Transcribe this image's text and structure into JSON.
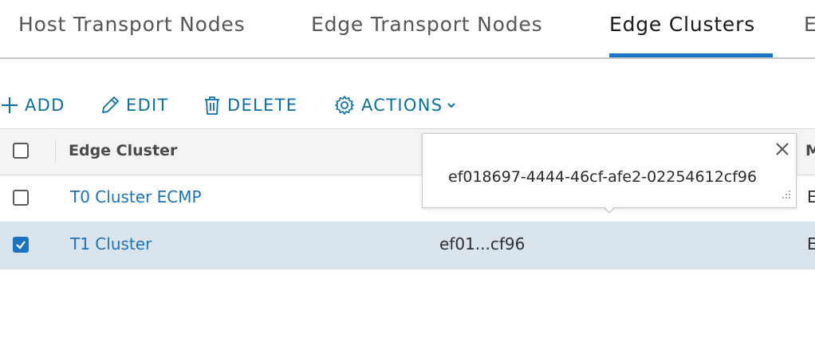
{
  "tabs": {
    "items": [
      {
        "label": "Host Transport Nodes"
      },
      {
        "label": "Edge Transport Nodes"
      },
      {
        "label": "Edge Clusters"
      },
      {
        "label": "E"
      }
    ],
    "active": "Edge Clusters"
  },
  "toolbar": {
    "add_label": "ADD",
    "edit_label": "EDIT",
    "delete_label": "DELETE",
    "actions_label": "ACTIONS"
  },
  "table": {
    "columns": {
      "name": "Edge Cluster",
      "right_partial": "M"
    },
    "rows": [
      {
        "name": "T0 Cluster ECMP",
        "id": "",
        "right_partial": "E",
        "checked": false
      },
      {
        "name": "T1 Cluster",
        "id": "ef01...cf96",
        "right_partial": "E",
        "checked": true
      }
    ]
  },
  "popover": {
    "text": "ef018697-4444-46cf-afe2-02254612cf96"
  },
  "colors": {
    "accent": "#1b73c1",
    "link": "#1e73b8",
    "selected_row": "#d9e4ec"
  }
}
